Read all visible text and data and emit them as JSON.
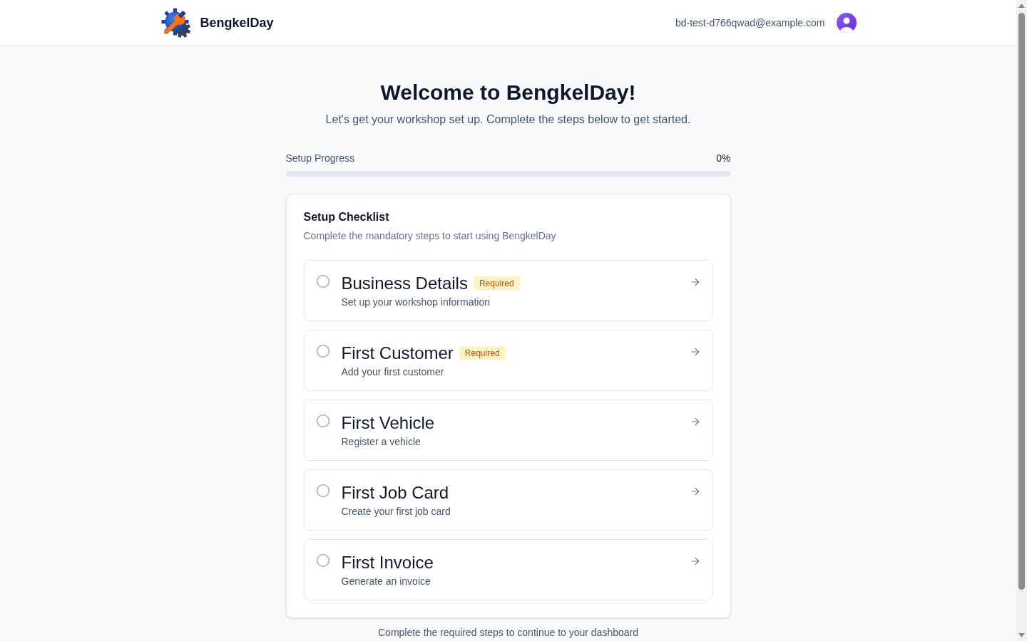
{
  "header": {
    "brand": "BengkelDay",
    "user_email": "bd-test-d766qwad@example.com"
  },
  "welcome": {
    "title": "Welcome to BengkelDay!",
    "subtitle": "Let's get your workshop set up. Complete the steps below to get started."
  },
  "progress": {
    "label": "Setup Progress",
    "reading": "0%",
    "level": 0
  },
  "checklist": {
    "title": "Setup Checklist",
    "description": "Complete the mandatory steps to start using BengkelDay",
    "steps": [
      {
        "title": "Business Details",
        "badge": "Required",
        "description": "Set up your workshop information",
        "completed": false
      },
      {
        "title": "First Customer",
        "badge": "Required",
        "description": "Add your first customer",
        "completed": false
      },
      {
        "title": "First Vehicle",
        "description": "Register a vehicle",
        "completed": false
      },
      {
        "title": "First Job Card",
        "description": "Create your first job card",
        "completed": false
      },
      {
        "title": "First Invoice",
        "description": "Generate an invoice",
        "completed": false
      }
    ]
  },
  "footer_note": "Complete the required steps to continue to your dashboard"
}
